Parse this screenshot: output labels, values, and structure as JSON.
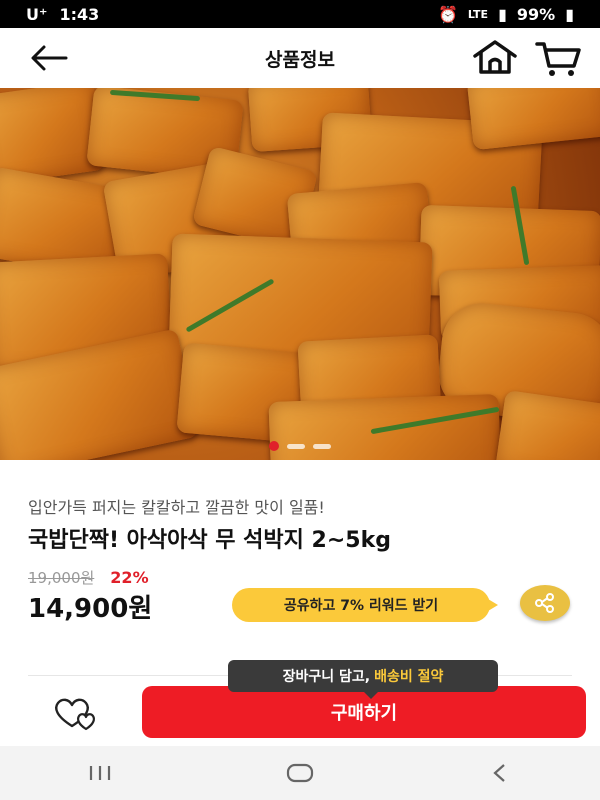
{
  "status_bar": {
    "carrier": "U⁺",
    "time": "1:43",
    "network": "LTE",
    "battery": "99%"
  },
  "header": {
    "title": "상품정보",
    "icons": [
      "back-arrow-icon",
      "home-icon",
      "cart-icon"
    ]
  },
  "product": {
    "subtitle": "입안가득 퍼지는 칼칼하고 깔끔한 맛이 일품!",
    "name": "국밥단짝! 아삭아삭 무 석박지 2~5kg",
    "original_price": "19,000원",
    "discount": "22%",
    "sale_price": "14,900원",
    "carousel": {
      "total": 3,
      "active": 1
    }
  },
  "share": {
    "badge_label": "공유하고 7% 리워드 받기",
    "icon": "share-icon"
  },
  "tooltip": {
    "prefix": "장바구니 담고,",
    "highlight": "배송비 절약"
  },
  "actions": {
    "buy_label": "구매하기",
    "wish_icon": "heart-icon"
  },
  "nav": {
    "icons": [
      "recent-apps-icon",
      "home-nav-icon",
      "back-nav-icon"
    ]
  },
  "colors": {
    "accent": "#ee1c25",
    "badge": "#fbc93a",
    "tooltip_bg": "#3a3a3a"
  }
}
